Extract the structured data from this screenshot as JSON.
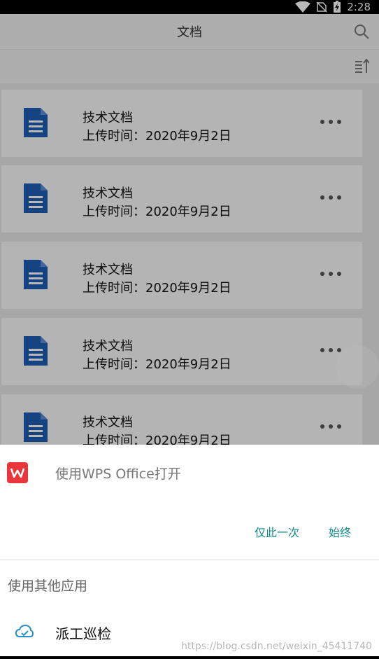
{
  "status_bar": {
    "time": "2:28",
    "icons": [
      "wifi-icon",
      "no-sim-icon",
      "battery-charging-icon"
    ]
  },
  "header": {
    "title": "文档",
    "search_icon": "search-icon",
    "sort_icon": "sort-icon"
  },
  "documents": [
    {
      "title": "技术文档",
      "date": "上传时间：2020年9月2日"
    },
    {
      "title": "技术文档",
      "date": "上传时间：2020年9月2日"
    },
    {
      "title": "技术文档",
      "date": "上传时间：2020年9月2日"
    },
    {
      "title": "技术文档",
      "date": "上传时间：2020年9月2日"
    },
    {
      "title": "技术文档",
      "date": "上传时间：2020年9月2日"
    }
  ],
  "dialog": {
    "open_with": "使用WPS Office打开",
    "just_once": "仅此一次",
    "always": "始终",
    "other_apps": "使用其他应用",
    "app_name": "派工巡检"
  },
  "watermark": "https://blog.csdn.net/weixin_45411740",
  "colors": {
    "accent": "#0e8a8a",
    "doc_blue": "#1e5cb3",
    "wps_red": "#e8363a"
  }
}
